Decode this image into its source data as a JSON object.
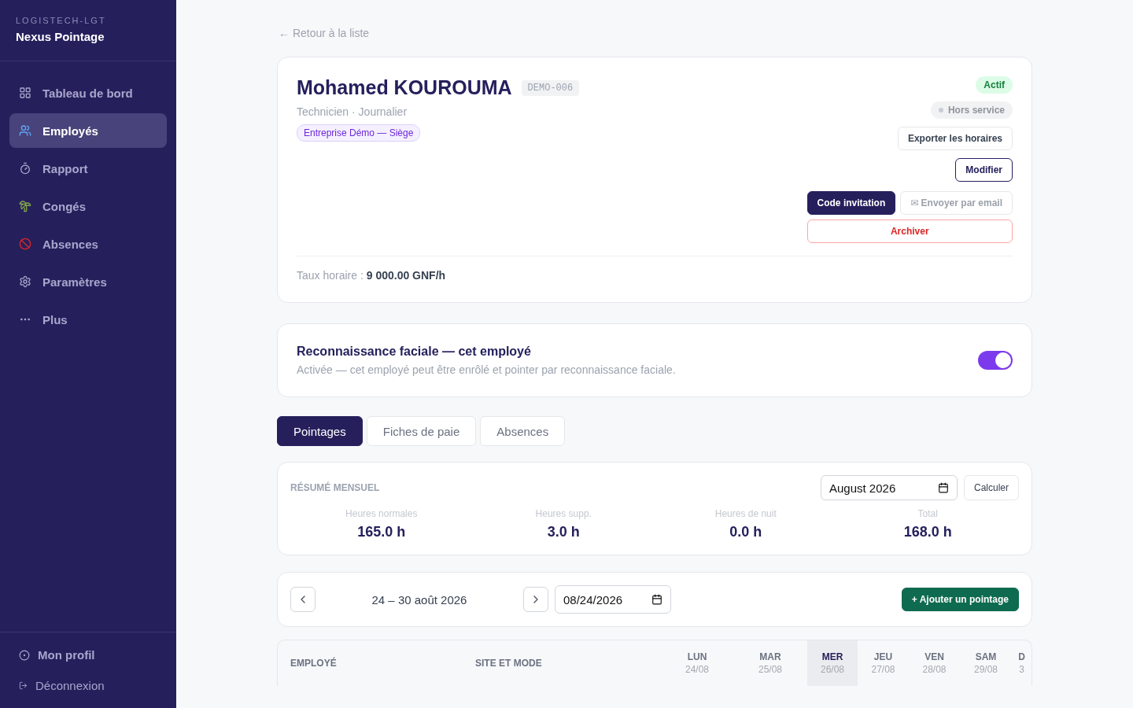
{
  "sidebar": {
    "org": "LOGISTECH-LGT",
    "app_name": "Nexus Pointage",
    "items": [
      {
        "label": "Tableau de bord",
        "selected": false
      },
      {
        "label": "Employés",
        "selected": true
      },
      {
        "label": "Rapport",
        "selected": false
      },
      {
        "label": "Congés",
        "selected": false
      },
      {
        "label": "Absences",
        "selected": false
      },
      {
        "label": "Paramètres",
        "selected": false
      },
      {
        "label": "Plus",
        "selected": false
      }
    ],
    "footer": [
      {
        "label": "Mon profil"
      },
      {
        "label": "Déconnexion"
      }
    ]
  },
  "back_link": "← Retour à la liste",
  "employee": {
    "name": "Mohamed KOUROUMA",
    "code": "DEMO-006",
    "role": "Technicien · Journalier",
    "company": "Entreprise Démo — Siège",
    "status": "Actif",
    "service_status": "Hors service",
    "actions": {
      "export": "Exporter les horaires",
      "edit": "Modifier",
      "invite": "Code invitation",
      "email": "✉ Envoyer par email",
      "archive": "Archiver"
    },
    "rate_label": "Taux horaire :",
    "rate_value": "9 000.00 GNF/h"
  },
  "facial": {
    "title": "Reconnaissance faciale — cet employé",
    "description": "Activée — cet employé peut être enrôlé et pointer par reconnaissance faciale.",
    "on": true
  },
  "tabs": [
    {
      "label": "Pointages",
      "selected": true
    },
    {
      "label": "Fiches de paie",
      "selected": false
    },
    {
      "label": "Absences",
      "selected": false
    }
  ],
  "summary": {
    "title": "RÉSUMÉ MENSUEL",
    "month": "August 2026",
    "compute": "Calculer",
    "stats": [
      {
        "label": "Heures normales",
        "value": "165.0 h"
      },
      {
        "label": "Heures supp.",
        "value": "3.0 h"
      },
      {
        "label": "Heures de nuit",
        "value": "0.0 h"
      },
      {
        "label": "Total",
        "value": "168.0 h"
      }
    ]
  },
  "week": {
    "range": "24 – 30 août 2026",
    "date": "08/24/2026",
    "add": "+ Ajouter un pointage"
  },
  "table": {
    "columns": [
      "EMPLOYÉ",
      "SITE ET MODE"
    ],
    "days": [
      {
        "day": "LUN",
        "date": "24/08",
        "selected": false
      },
      {
        "day": "MAR",
        "date": "25/08",
        "selected": false
      },
      {
        "day": "MER",
        "date": "26/08",
        "selected": true
      },
      {
        "day": "JEU",
        "date": "27/08",
        "selected": false
      },
      {
        "day": "VEN",
        "date": "28/08",
        "selected": false
      },
      {
        "day": "SAM",
        "date": "29/08",
        "selected": false
      },
      {
        "day": "D",
        "date": "3",
        "selected": false
      }
    ]
  }
}
